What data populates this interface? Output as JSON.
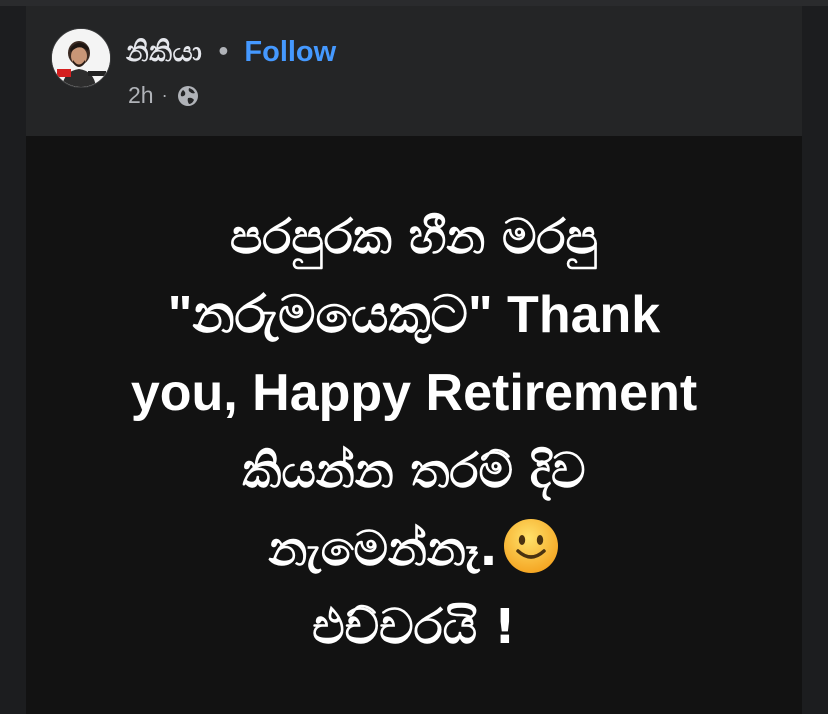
{
  "post": {
    "author": "නිකියා",
    "separator": "•",
    "follow_label": "Follow",
    "timestamp": "2h",
    "meta_separator": "·",
    "audience_icon": "globe-icon",
    "avatar_icon": "profile-photo-avatar"
  },
  "body": {
    "lines": [
      "පරපුරක හීන මරපු",
      "\"නරුමයෙකුට\" Thank",
      "you, Happy Retirement",
      "කියන්න තරම් දිව",
      "නැමෙන්නෑ.",
      "එච්චරයි !"
    ],
    "emoji_icon": "slightly-smiling-face-icon"
  },
  "colors": {
    "card_background": "#242526",
    "body_background": "#121212",
    "follow_link": "#4599ff",
    "text_primary": "#e4e6eb",
    "text_secondary": "#b0b3b8",
    "post_text": "#ffffff"
  }
}
